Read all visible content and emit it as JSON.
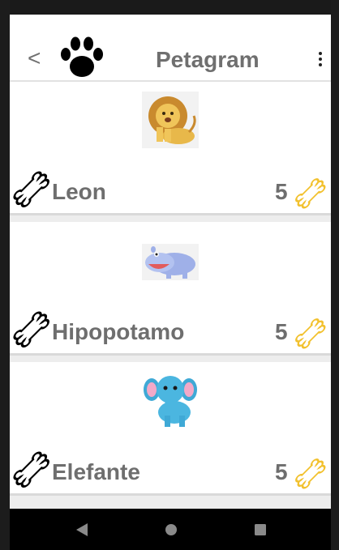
{
  "appbar": {
    "back_label": "<",
    "title": "Petagram",
    "logo_icon": "paw-print-icon",
    "menu_icon": "overflow-menu-icon"
  },
  "pets": [
    {
      "name": "Leon",
      "likes": "5",
      "image": "lion-illustration"
    },
    {
      "name": "Hipopotamo",
      "likes": "5",
      "image": "hippo-illustration"
    },
    {
      "name": "Elefante",
      "likes": "5",
      "image": "elephant-illustration"
    }
  ],
  "icons": {
    "like_outline": "bone-outline-icon",
    "like_count": "bone-yellow-icon"
  },
  "colors": {
    "text_gray": "#6e6e6e",
    "bone_yellow": "#f2c12e",
    "appbar_bg": "#ffffff",
    "screen_bg": "#ededed"
  },
  "navbar": {
    "buttons": [
      "back-nav-icon",
      "home-nav-icon",
      "recents-nav-icon"
    ]
  }
}
